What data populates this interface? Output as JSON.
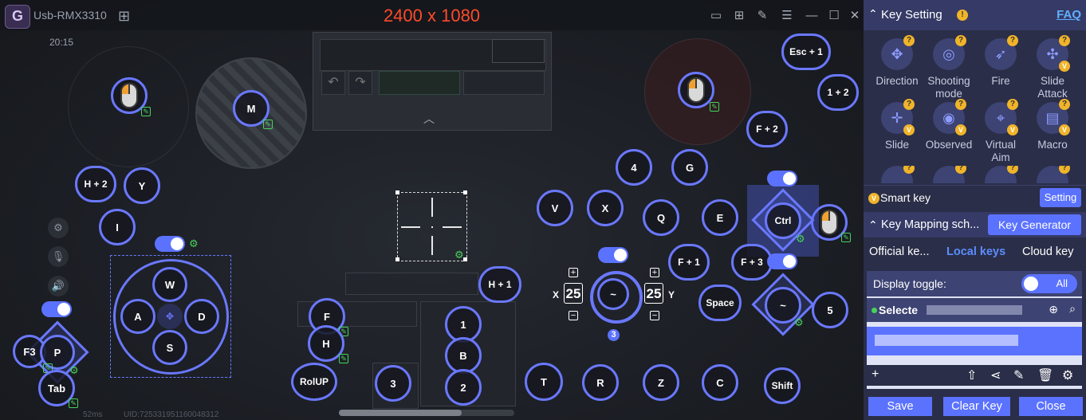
{
  "titlebar": {
    "logo_letter": "G",
    "device_name": "Usb-RMX3310",
    "resolution": "2400 x 1080"
  },
  "game": {
    "time": "20:15",
    "fps": "52ms",
    "uid": "UID:725331951160048312"
  },
  "keys": {
    "m": "M",
    "esc1": "Esc + 1",
    "one_two": "1 + 2",
    "f2": "F + 2",
    "h2": "H + 2",
    "y": "Y",
    "i": "I",
    "four": "4",
    "g": "G",
    "v": "V",
    "x": "X",
    "q": "Q",
    "e": "E",
    "ctrl": "Ctrl",
    "f1": "F + 1",
    "f3": "F + 3",
    "h1": "H + 1",
    "w": "W",
    "a": "A",
    "s": "S",
    "d": "D",
    "p": "P",
    "f3b": "F3",
    "tab": "Tab",
    "f": "F",
    "h": "H",
    "one": "1",
    "b": "B",
    "two": "2",
    "three": "3",
    "rollup": "RolUP",
    "t": "T",
    "r": "R",
    "z": "Z",
    "c": "C",
    "shift": "Shift",
    "space": "Space",
    "tilde_top": "~",
    "tilde_right": "~",
    "five": "5"
  },
  "sensitivity": {
    "x_label": "X",
    "y_label": "Y",
    "x_value": "25",
    "y_value": "25",
    "badge": "3"
  },
  "panel": {
    "key_setting_title": "Key Setting",
    "faq": "FAQ",
    "tools": [
      {
        "label": "Direction"
      },
      {
        "label": "Shooting mode"
      },
      {
        "label": "Fire"
      },
      {
        "label": "Slide Attack"
      },
      {
        "label": "Slide"
      },
      {
        "label": "Observed"
      },
      {
        "label": "Virtual Aim"
      },
      {
        "label": "Macro"
      }
    ],
    "smart_key": "Smart key",
    "setting_button": "Setting",
    "mapping_scheme": "Key Mapping sch...",
    "key_generator": "Key Generator",
    "tabs": [
      "Official ke...",
      "Local keys",
      "Cloud key"
    ],
    "display_toggle": "Display toggle:",
    "toggle_value": "All",
    "selected_label": "Selecte",
    "footer": {
      "save": "Save",
      "clear": "Clear Key",
      "close": "Close"
    }
  },
  "colors": {
    "accent": "#5b72ff",
    "resolution_text": "#ff4a2b",
    "edit_green": "#47d25a",
    "info_yellow": "#f0b429"
  }
}
